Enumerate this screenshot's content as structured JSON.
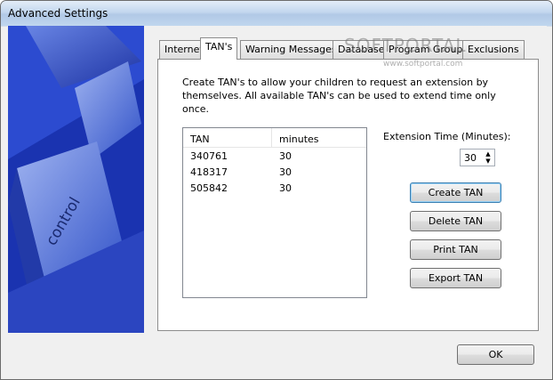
{
  "window": {
    "title": "Advanced Settings"
  },
  "tabs": [
    {
      "label": "Internet",
      "active": false
    },
    {
      "label": "TAN's",
      "active": true
    },
    {
      "label": "Warning Messages",
      "active": false
    },
    {
      "label": "Database",
      "active": false
    },
    {
      "label": "Program Groups",
      "active": false
    },
    {
      "label": "Exclusions",
      "active": false
    }
  ],
  "panel": {
    "description": "Create TAN's to allow your children to request an extension by themselves. All available TAN's can be used to extend time only once.",
    "list": {
      "columns": [
        "TAN",
        "minutes"
      ],
      "rows": [
        {
          "tan": "340761",
          "minutes": "30"
        },
        {
          "tan": "418317",
          "minutes": "30"
        },
        {
          "tan": "505842",
          "minutes": "30"
        }
      ]
    },
    "extension_label": "Extension Time (Minutes):",
    "extension_value": "30",
    "buttons": {
      "create": "Create TAN",
      "delete": "Delete TAN",
      "print": "Print TAN",
      "export": "Export TAN"
    }
  },
  "ok_label": "OK",
  "banner_key_label": "control",
  "watermark": {
    "main": "SOFTPORTAL",
    "sub": "www.softportal.com"
  }
}
